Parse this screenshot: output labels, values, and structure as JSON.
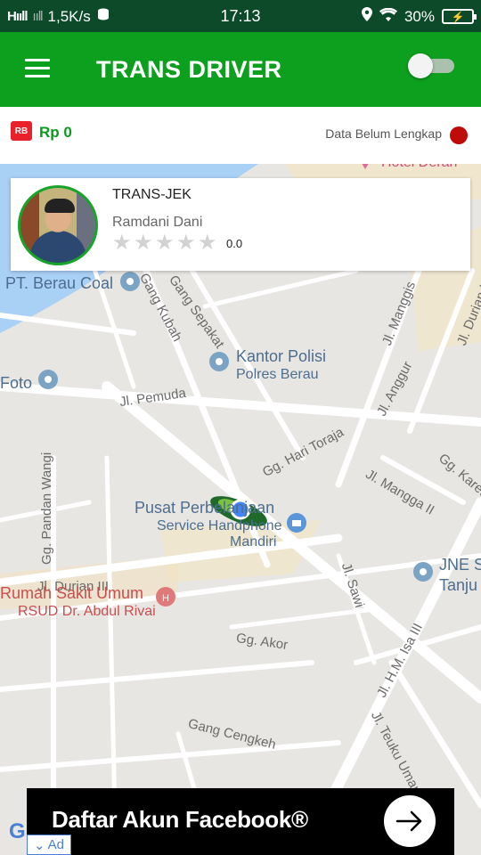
{
  "status_bar": {
    "signal": "Hııll",
    "signal2": "ııll",
    "speed": "1,5K/s",
    "time": "17:13",
    "battery": "30%"
  },
  "app_bar": {
    "title": "TRANS DRIVER",
    "toggle_on": false
  },
  "balance_bar": {
    "wallet_icon": "RB",
    "balance": "Rp 0",
    "data_status": "Data Belum Lengkap",
    "status_color": "#c00b0b"
  },
  "driver_card": {
    "title": "TRANS-JEK",
    "name": "Ramdani Dani",
    "rating": "0.0",
    "stars": 0
  },
  "map": {
    "labels": {
      "pt_berau_coal": "PT. Berau Coal",
      "gang_kubah": "Gang Kubah",
      "gang_sepakat": "Gang Sepakat",
      "jl_manggis": "Jl. Manggis",
      "jl_durian_i": "Jl. Durian I",
      "foto": "Foto",
      "kantor_polisi": "Kantor Polisi",
      "polres_berau": "Polres Berau",
      "jl_pemuda": "Jl. Pemuda",
      "jl_anggur": "Jl. Anggur",
      "gg_hari_toraja": "Gg. Hari Toraja",
      "jl_mangga_ii": "Jl. Mangga II",
      "gg_karet": "Gg. Karet",
      "gg_pandan_wangi": "Gg. Pandan Wangi",
      "pusat_perbelanjaan": "Pusat Perbelanjaan",
      "service_handphone": "Service Handphone",
      "mandiri": "Mandiri",
      "jne": "JNE S",
      "tanjung": "Tanju",
      "jl_durian_iii": "Jl. Durian III",
      "rumah_sakit": "Rumah Sakit Umum",
      "rsud": "RSUD Dr. Abdul Rivai",
      "jl_sawi": "Jl. Sawi",
      "gg_akor": "Gg. Akor",
      "jl_hm_isa": "Jl. H.M. Isa III",
      "gang_cengkeh": "Gang Cengkeh",
      "jl_teuku_umar": "Jl. Teuku Umar",
      "hotel": "Hotel Derah"
    }
  },
  "ad": {
    "text": "Daftar Akun Facebook®",
    "badge": "Ad",
    "google": "G"
  }
}
